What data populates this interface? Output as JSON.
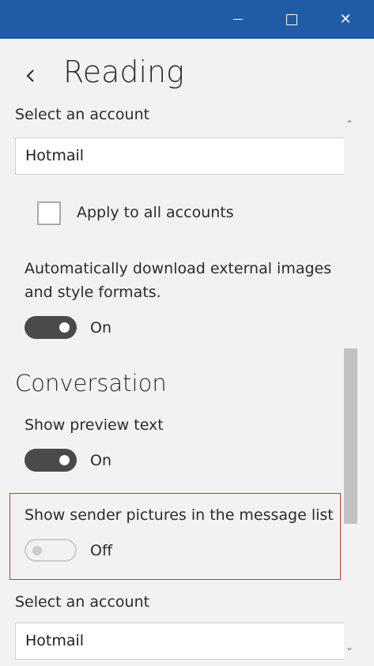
{
  "titlebar": {
    "minimize_icon": "minimize-icon",
    "maximize_icon": "maximize-icon",
    "close_icon": "close-icon",
    "close_glyph": "✕",
    "color": "#1f5ca5"
  },
  "header": {
    "back_icon": "chevron-left-icon",
    "title": "Reading"
  },
  "settings": {
    "account_label_top": "Select an account",
    "account_value_top": "Hotmail",
    "apply_all_label": "Apply to all accounts",
    "apply_all_checked": false,
    "download_images_label_line1": "Automatically download external images",
    "download_images_label_line2": "and style formats.",
    "download_images_state": "On",
    "conversation_heading": "Conversation",
    "preview_text_label": "Show preview text",
    "preview_text_state": "On",
    "sender_pictures_label": "Show sender pictures in the message list",
    "sender_pictures_state": "Off",
    "account_label_bottom": "Select an account",
    "account_value_bottom": "Hotmail"
  },
  "scrollbar": {
    "up_glyph": "⌃",
    "down_glyph": "⌄"
  },
  "colors": {
    "highlight_border": "#c4343a",
    "toggle_on": "#4a4a4a",
    "background": "#f2f2f2"
  }
}
